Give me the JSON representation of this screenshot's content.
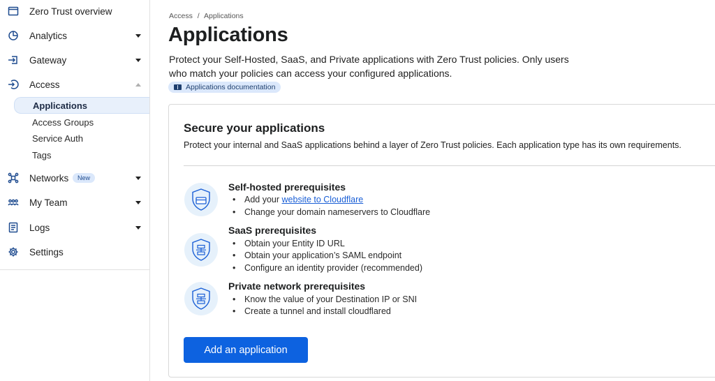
{
  "sidebar": {
    "items": [
      {
        "label": "Zero Trust overview",
        "icon": "browser-window-icon"
      },
      {
        "label": "Analytics",
        "icon": "pie-chart-icon"
      },
      {
        "label": "Gateway",
        "icon": "gateway-icon"
      },
      {
        "label": "Access",
        "icon": "access-icon"
      },
      {
        "label": "Networks",
        "icon": "network-icon",
        "badge": "New"
      },
      {
        "label": "My Team",
        "icon": "team-icon"
      },
      {
        "label": "Logs",
        "icon": "logs-icon"
      },
      {
        "label": "Settings",
        "icon": "gear-icon"
      }
    ],
    "access_subitems": [
      {
        "label": "Applications",
        "active": true
      },
      {
        "label": "Access Groups"
      },
      {
        "label": "Service Auth"
      },
      {
        "label": "Tags"
      }
    ]
  },
  "breadcrumb": {
    "parent": "Access",
    "separator": "/",
    "current": "Applications"
  },
  "page": {
    "title": "Applications",
    "description": "Protect your Self-Hosted, SaaS, and Private applications with Zero Trust policies. Only users who match your policies can access your configured applications.",
    "doc_link": "Applications documentation"
  },
  "card": {
    "title": "Secure your applications",
    "subtitle": "Protect your internal and SaaS applications behind a layer of Zero Trust policies. Each application type has its own requirements.",
    "self_hosted": {
      "title": "Self-hosted prerequisites",
      "bullet1_prefix": "Add your ",
      "bullet1_link": "website to Cloudflare",
      "bullet2": "Change your domain nameservers to Cloudflare"
    },
    "saas": {
      "title": "SaaS prerequisites",
      "bullets": [
        "Obtain your Entity ID URL",
        "Obtain your application’s SAML endpoint",
        "Configure an identity provider (recommended)"
      ]
    },
    "private": {
      "title": "Private network prerequisites",
      "bullets": [
        "Know the value of your Destination IP or SNI",
        "Create a tunnel and install cloudflared"
      ]
    },
    "button_label": "Add an application"
  },
  "colors": {
    "accent": "#0d62e0",
    "icon_blue": "#1e4b8f",
    "chip_bg": "#dbe8fb"
  }
}
